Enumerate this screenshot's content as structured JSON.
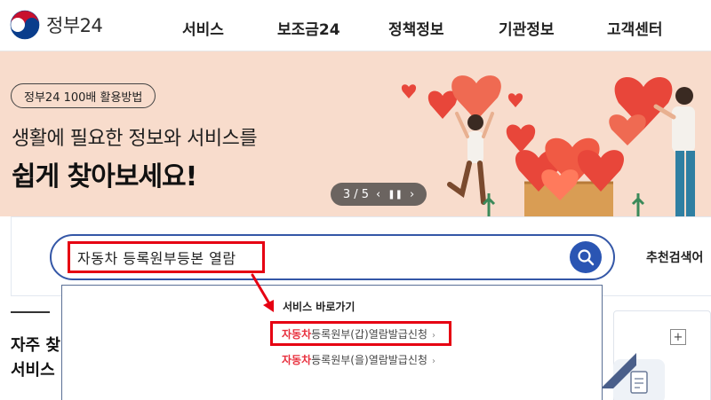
{
  "header": {
    "logo_text": "정부24",
    "nav": [
      "서비스",
      "보조금24",
      "정책정보",
      "기관정보",
      "고객센터"
    ]
  },
  "banner": {
    "pill": "정부24 100배 활용방법",
    "title_line1": "생활에 필요한 정보와 서비스를",
    "title_line2": "쉽게 찾아보세요!",
    "pager": "3 / 5",
    "prev_icon": "chevron-left-icon",
    "pause_icon": "pause-icon",
    "next_icon": "chevron-right-icon",
    "bg_color": "#f8dccc"
  },
  "search": {
    "value": "자동차 등록원부등본 열람",
    "button_icon": "search-icon",
    "recommend_label": "추천검색어",
    "accent_color": "#2a55b3"
  },
  "dropdown": {
    "title": "서비스 바로가기",
    "items": [
      {
        "highlight": "자동차",
        "rest": "등록원부(갑)열람발급신청"
      },
      {
        "highlight": "자동차",
        "rest": "등록원부(을)열람발급신청"
      }
    ],
    "highlight_color": "#e8303e"
  },
  "left_section": {
    "title_line1": "자주 찾",
    "title_line2": "서비스"
  },
  "right_section": {
    "plus_label": "+"
  },
  "annotation_color": "#e60012"
}
